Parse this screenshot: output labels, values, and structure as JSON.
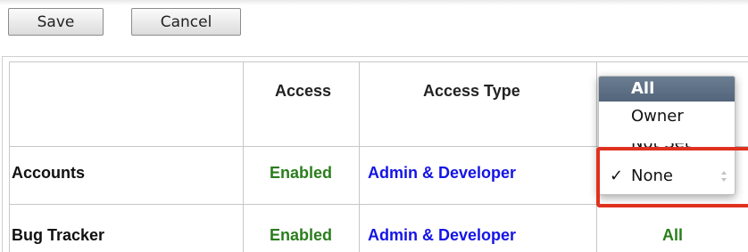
{
  "toolbar": {
    "save_label": "Save",
    "cancel_label": "Cancel"
  },
  "table": {
    "headers": [
      "",
      "Access",
      "Access Type"
    ],
    "rows": [
      {
        "module": "Accounts",
        "access": "Enabled",
        "access_type": "Admin & Developer"
      },
      {
        "module": "Bug Tracker",
        "access": "Enabled",
        "access_type": "Admin & Developer",
        "last_value": "All"
      }
    ]
  },
  "dropdown": {
    "options": [
      "All",
      "Owner",
      "Not Set",
      "None"
    ],
    "highlighted": "All",
    "selected": "None",
    "check_glyph": "✓"
  },
  "colors": {
    "enabled": "#2a7d1d",
    "link": "#1414e6",
    "highlight_box": "#e0311f",
    "menu_highlight": "#5f7186"
  }
}
